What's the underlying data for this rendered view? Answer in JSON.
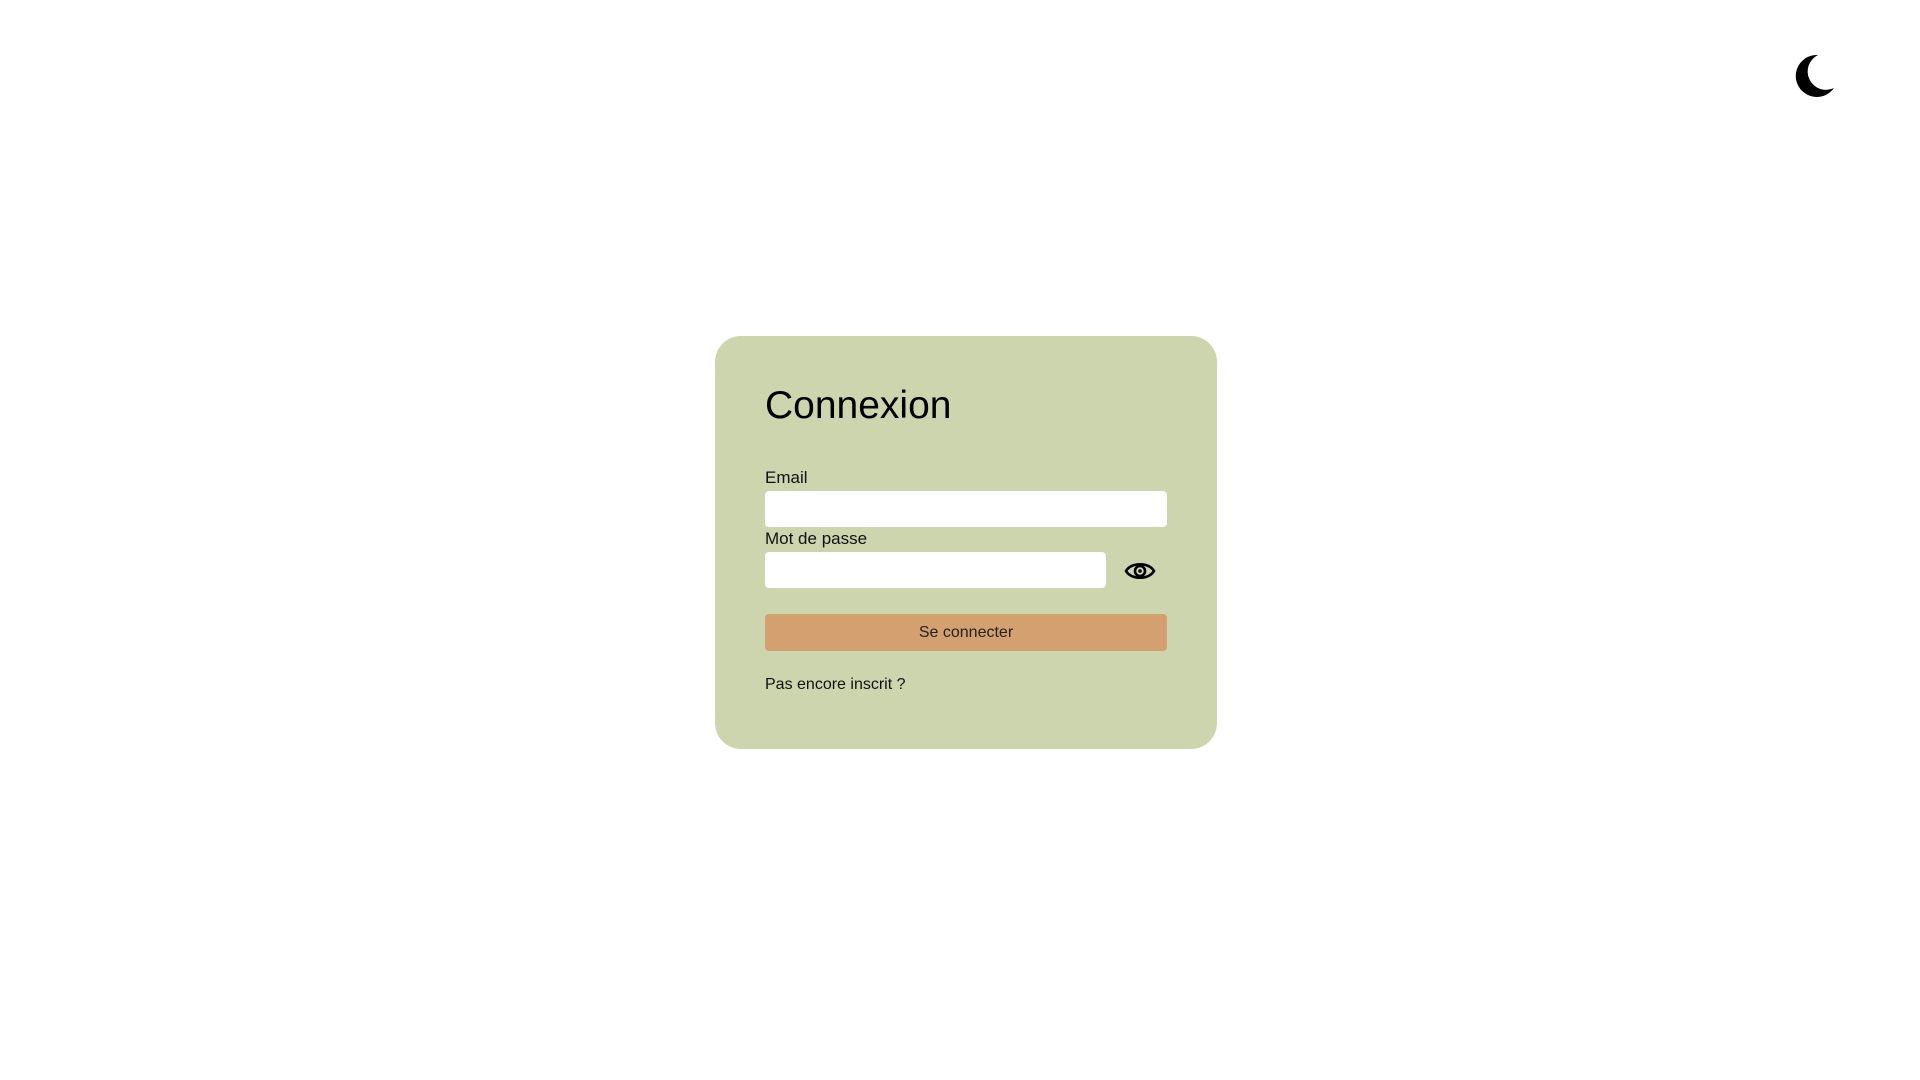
{
  "header": {
    "theme_toggle_icon": "moon-icon"
  },
  "login": {
    "title": "Connexion",
    "email_label": "Email",
    "email_value": "",
    "password_label": "Mot de passe",
    "password_value": "",
    "toggle_password_icon": "eye-icon",
    "submit_label": "Se connecter",
    "signup_link": "Pas encore inscrit ?"
  },
  "colors": {
    "card_background": "#cdd5ae",
    "button_background": "#d4a070",
    "page_background": "#ffffff"
  }
}
